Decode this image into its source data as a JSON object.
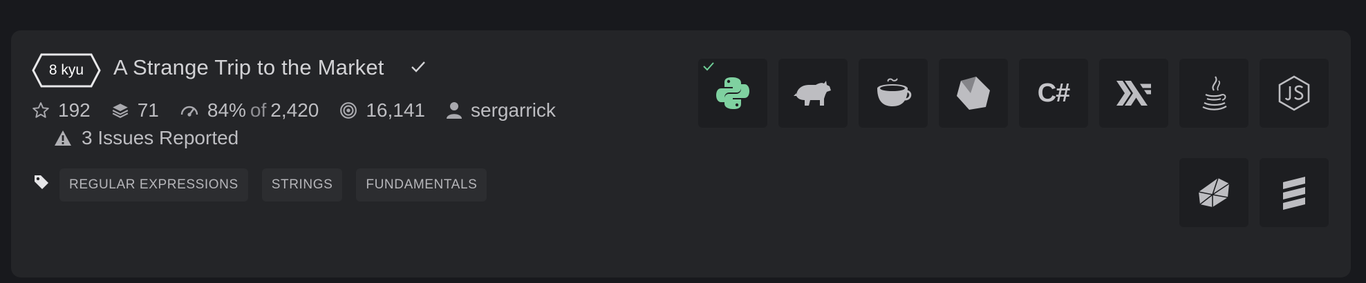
{
  "kata": {
    "rank": "8 kyu",
    "title": "A Strange Trip to the Market",
    "completed": true
  },
  "stats": {
    "stars": "192",
    "collections": "71",
    "satisfaction": "84%",
    "of_word": "of",
    "votes": "2,420",
    "completions": "16,141",
    "author": "sergarrick"
  },
  "issues": {
    "label": "3 Issues Reported"
  },
  "tags": [
    "REGULAR EXPRESSIONS",
    "STRINGS",
    "FUNDAMENTALS"
  ],
  "languages": [
    {
      "name": "Python",
      "icon": "python-icon",
      "trained": true
    },
    {
      "name": "Elixir / Erlang",
      "icon": "rhino-icon",
      "trained": false
    },
    {
      "name": "CoffeeScript",
      "icon": "coffeescript-icon",
      "trained": false
    },
    {
      "name": "Crystal",
      "icon": "crystal-icon",
      "trained": false
    },
    {
      "name": "C#",
      "icon": "csharp-icon",
      "label": "C#",
      "trained": false
    },
    {
      "name": "Haskell",
      "icon": "haskell-icon",
      "trained": false
    },
    {
      "name": "Java",
      "icon": "java-icon",
      "trained": false
    },
    {
      "name": "JavaScript",
      "icon": "javascript-icon",
      "trained": false
    },
    {
      "name": "Ruby",
      "icon": "ruby-icon",
      "trained": false
    },
    {
      "name": "Scala",
      "icon": "scala-icon",
      "trained": false
    }
  ],
  "colors": {
    "background": "#18191d",
    "card": "#242528",
    "tile": "#1d1e21",
    "python_accent": "#7fd1a0",
    "check_accent": "#6fcf97",
    "text": "#c9c9cc"
  }
}
